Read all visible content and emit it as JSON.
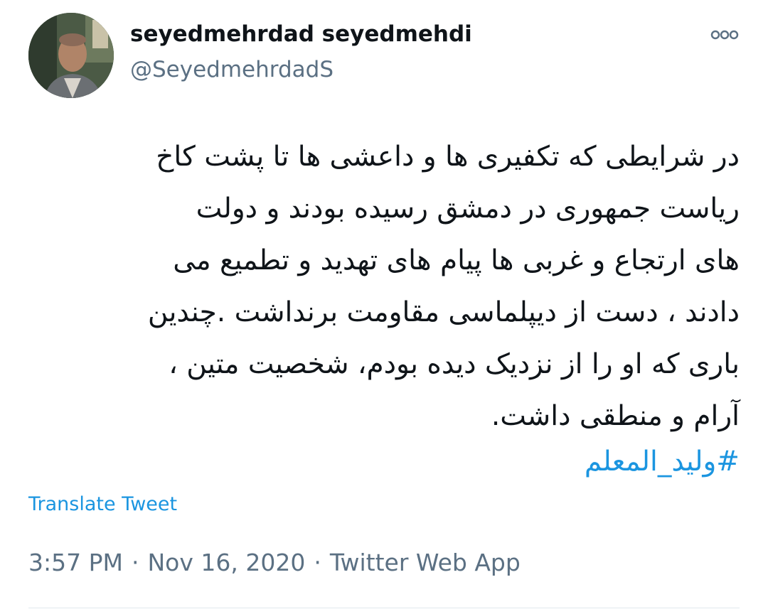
{
  "author": {
    "display_name": "seyedmehrdad seyedmehdi",
    "handle": "@SeyedmehrdadS"
  },
  "tweet": {
    "lines": [
      "در شرایطی که تکفیری ها و داعشی ها تا پشت کاخ",
      "ریاست جمهوری در دمشق رسیده بودند و دولت",
      "های ارتجاع و غربی ها پیام های تهدید و تطمیع می",
      "دادند ، دست از دیپلماسی مقاومت برنداشت .چندین",
      "باری که او را از نزدیک دیده بودم، شخصیت متین ،",
      "آرام و منطقی داشت."
    ],
    "hashtag": "#ولید_المعلم",
    "translate_label": "Translate Tweet",
    "time": "3:57 PM",
    "date": "Nov 16, 2020",
    "separator": "·",
    "source": "Twitter Web App"
  },
  "icons": {
    "more": "more-options-icon",
    "avatar": "profile-photo"
  },
  "colors": {
    "link": "#1b95e0",
    "text": "#0f1419",
    "secondary": "#5b7083"
  }
}
